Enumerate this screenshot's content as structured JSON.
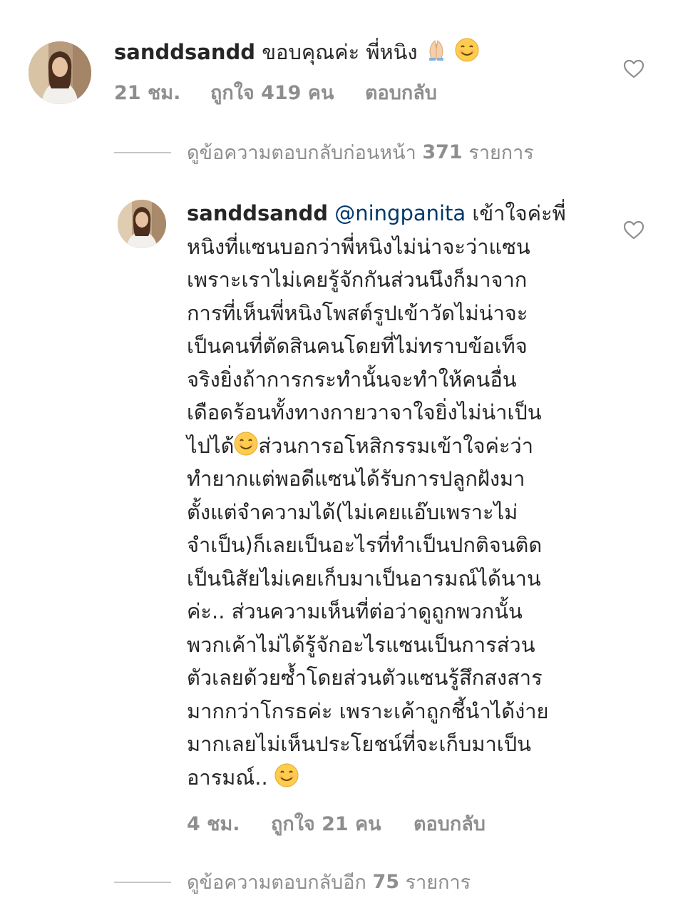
{
  "comment1": {
    "username": "sanddsandd",
    "text": "ขอบคุณค่ะ พี่หนิง",
    "emojis": [
      "folded-hands-emoji",
      "smiling-face-emoji"
    ],
    "time": "21 ชม.",
    "likes_prefix": "ถูกใจ",
    "likes_count": "419",
    "likes_suffix": "คน",
    "reply_label": "ตอบกลับ"
  },
  "view_previous_replies": {
    "prefix": "ดูข้อความตอบกลับก่อนหน้า",
    "count": "371",
    "suffix": "รายการ"
  },
  "comment2": {
    "username": "sanddsandd",
    "mention": "@ningpanita",
    "lines": [
      "เข้าใจค่ะพี่",
      "หนิงที่แซนบอกว่าพี่หนิงไม่น่าจะว่าแซน",
      "เพราะเราไม่เคยรู้จักกันส่วนนึงก็มาจาก",
      "การที่เห็นพี่หนิงโพสต์รูปเข้าวัดไม่น่าจะ",
      "เป็นคนที่ตัดสินคนโดยที่ไม่ทราบข้อเท็จ",
      "จริงยิ่งถ้าการกระทำนั้นจะทำให้คนอื่น",
      "เดือดร้อนทั้งทางกายวาจาใจยิ่งไม่น่าเป็น",
      "ไปได้",
      "ส่วนการอโหสิกรรมเข้าใจค่ะว่า",
      "ทำยากแต่พอดีแซนได้รับการปลูกฝังมา",
      "ตั้งแต่จำความได้(ไม่เคยแอ๊บเพราะไม่",
      "จำเป็น)ก็เลยเป็นอะไรที่ทำเป็นปกติจนติด",
      "เป็นนิสัยไม่เคยเก็บมาเป็นอารมณ์ได้นาน",
      "ค่ะ.. ส่วนความเห็นที่ต่อว่าดูถูกพวกนั้น",
      "พวกเค้าไม่ได้รู้จักอะไรแซนเป็นการส่วน",
      "ตัวเลยด้วยซ้ำโดยส่วนตัวแซนรู้สึกสงสาร",
      "มากกว่าโกรธค่ะ เพราะเค้าถูกชี้นำได้ง่าย",
      "มากเลยไม่เห็นประโยชน์ที่จะเก็บมาเป็น",
      "อารมณ์.."
    ],
    "emojis": [
      "smiling-face-emoji"
    ],
    "time": "4 ชม.",
    "likes_prefix": "ถูกใจ",
    "likes_count": "21",
    "likes_suffix": "คน",
    "reply_label": "ตอบกลับ"
  },
  "view_more_replies": {
    "prefix": "ดูข้อความตอบกลับอีก",
    "count": "75",
    "suffix": "รายการ"
  },
  "colors": {
    "text": "#262626",
    "secondary": "#8e8e8e",
    "mention": "#00376b",
    "emoji_face": "#ffcc4d"
  }
}
